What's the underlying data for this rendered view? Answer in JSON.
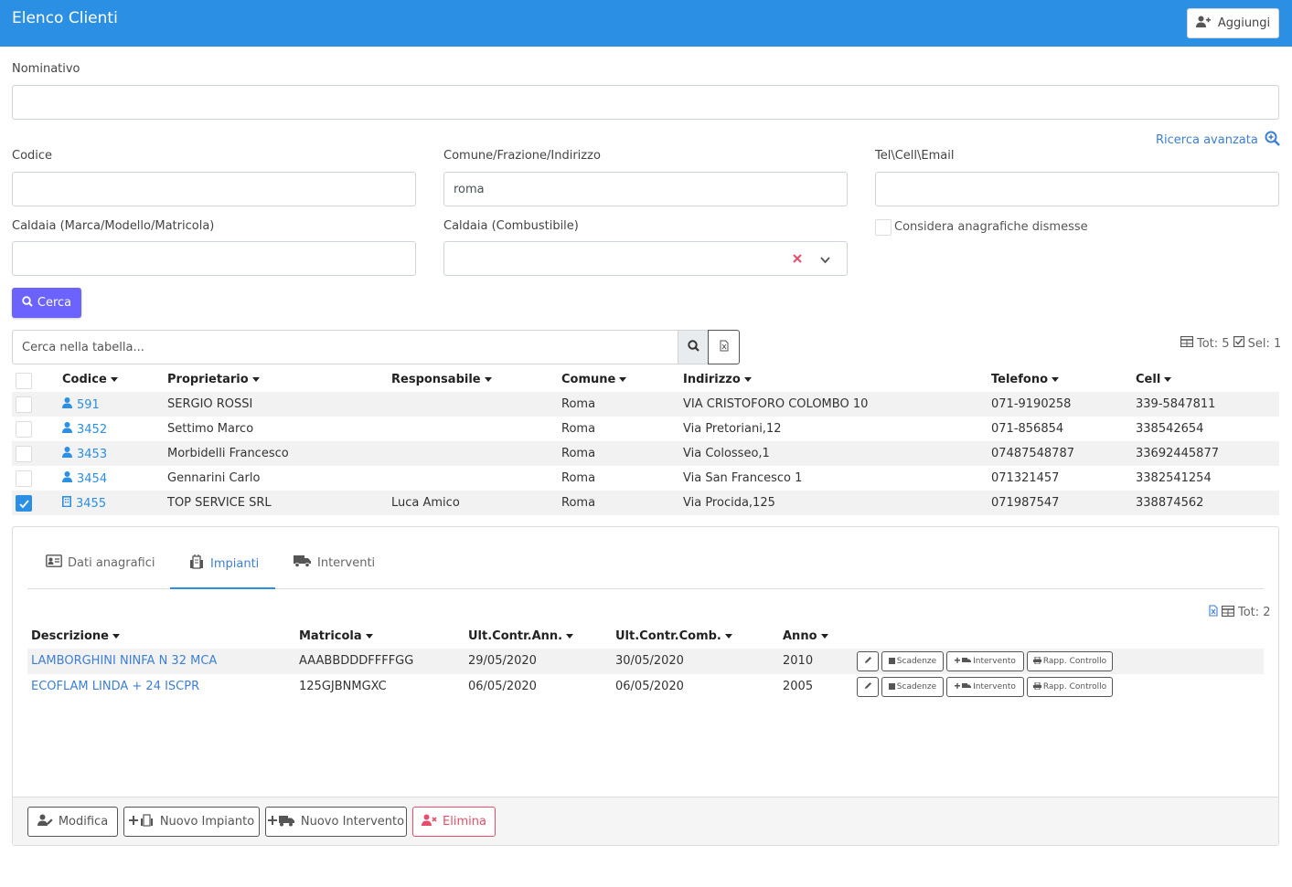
{
  "header": {
    "title": "Elenco Clienti",
    "add_label": "Aggiungi"
  },
  "filters": {
    "nominativo_label": "Nominativo",
    "nominativo_value": "",
    "advanced_search": "Ricerca avanzata",
    "codice_label": "Codice",
    "codice_value": "",
    "comune_label": "Comune/Frazione/Indirizzo",
    "comune_value": "roma",
    "tel_label": "Tel\\Cell\\Email",
    "tel_value": "",
    "caldaia_label": "Caldaia (Marca/Modello/Matricola)",
    "caldaia_value": "",
    "combustibile_label": "Caldaia (Combustibile)",
    "combustibile_value": "",
    "dismesse_label": "Considera anagrafiche dismesse",
    "dismesse_checked": false,
    "search_button": "Cerca"
  },
  "table": {
    "search_placeholder": "Cerca nella tabella...",
    "tot_label": "Tot: 5",
    "sel_label": "Sel: 1",
    "columns": [
      "Codice",
      "Proprietario",
      "Responsabile",
      "Comune",
      "Indirizzo",
      "Telefono",
      "Cell"
    ],
    "rows": [
      {
        "selected": false,
        "icon": "user-icon",
        "codice": "591",
        "proprietario": "SERGIO ROSSI",
        "responsabile": "",
        "comune": "Roma",
        "indirizzo": "VIA CRISTOFORO COLOMBO 10",
        "telefono": "071-9190258",
        "cell": "339-5847811"
      },
      {
        "selected": false,
        "icon": "user-icon",
        "codice": "3452",
        "proprietario": "Settimo Marco",
        "responsabile": "",
        "comune": "Roma",
        "indirizzo": "Via Pretoriani,12",
        "telefono": "071-856854",
        "cell": "338542654"
      },
      {
        "selected": false,
        "icon": "user-icon",
        "codice": "3453",
        "proprietario": "Morbidelli Francesco",
        "responsabile": "",
        "comune": "Roma",
        "indirizzo": "Via Colosseo,1",
        "telefono": "07487548787",
        "cell": "33692445877"
      },
      {
        "selected": false,
        "icon": "user-icon",
        "codice": "3454",
        "proprietario": "Gennarini Carlo",
        "responsabile": "",
        "comune": "Roma",
        "indirizzo": "Via San Francesco 1",
        "telefono": "071321457",
        "cell": "3382541254"
      },
      {
        "selected": true,
        "icon": "building-icon",
        "codice": "3455",
        "proprietario": "TOP SERVICE SRL",
        "responsabile": "Luca Amico",
        "comune": "Roma",
        "indirizzo": "Via Procida,125",
        "telefono": "071987547",
        "cell": "338874562"
      }
    ]
  },
  "detail": {
    "tabs": [
      "Dati anagrafici",
      "Impianti",
      "Interventi"
    ],
    "active_tab": "Impianti",
    "tot_label": "Tot: 2",
    "columns": [
      "Descrizione",
      "Matricola",
      "Ult.Contr.Ann.",
      "Ult.Contr.Comb.",
      "Anno"
    ],
    "rows": [
      {
        "descrizione": "LAMBORGHINI NINFA N 32 MCA",
        "matricola": "AAABBDDDFFFFGG",
        "ann": "29/05/2020",
        "comb": "30/05/2020",
        "anno": "2010"
      },
      {
        "descrizione": "ECOFLAM LINDA + 24 ISCPR",
        "matricola": "125GJBNMGXC",
        "ann": "06/05/2020",
        "comb": "06/05/2020",
        "anno": "2005"
      }
    ],
    "row_buttons": {
      "scadenze": "Scadenze",
      "intervento": "Intervento",
      "rapp": "Rapp. Controllo"
    },
    "footer": {
      "modifica": "Modifica",
      "nuovo_impianto": "Nuovo Impianto",
      "nuovo_intervento": "Nuovo Intervento",
      "elimina": "Elimina"
    }
  },
  "colors": {
    "header": "#2b8fe3",
    "cerca": "#6c63ff",
    "link": "#3d7fd6",
    "danger": "#e84e6a"
  }
}
